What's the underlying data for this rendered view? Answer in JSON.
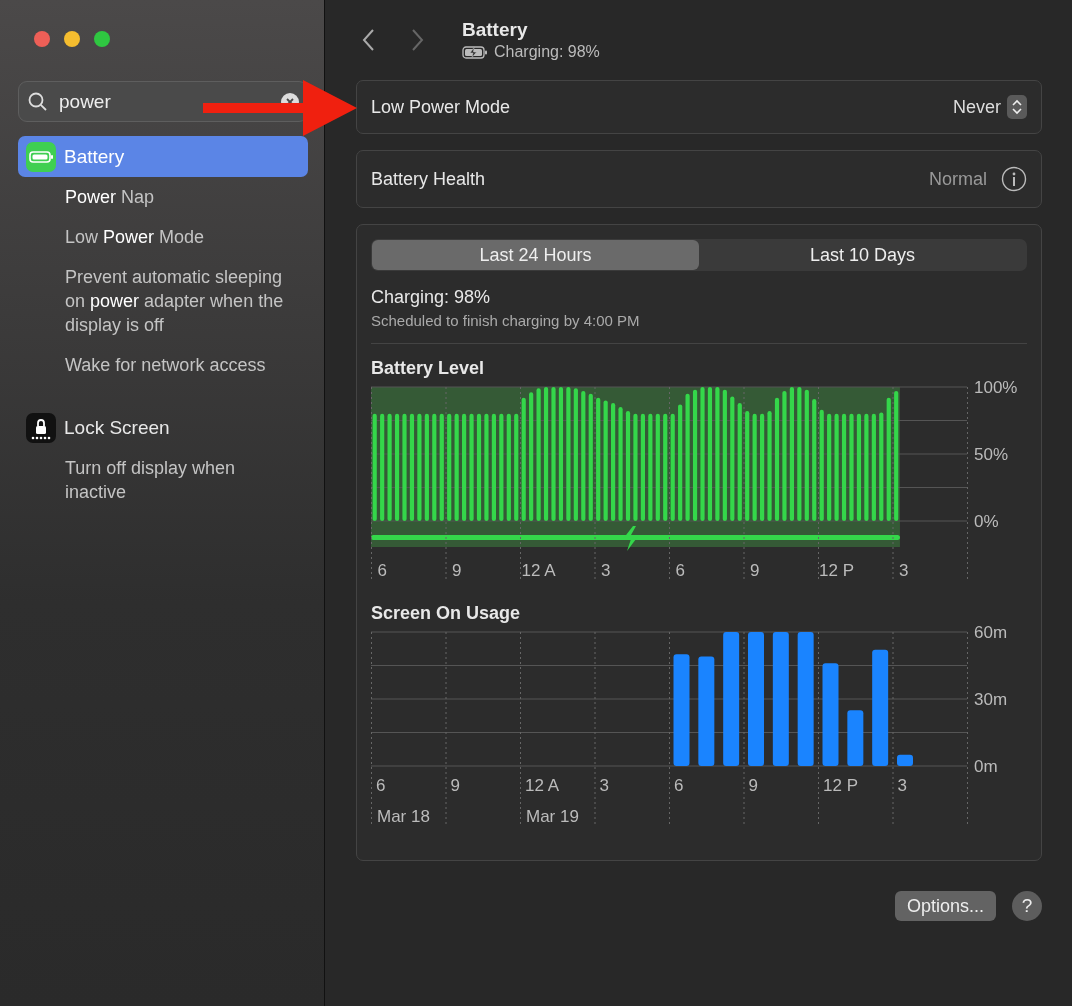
{
  "window": {
    "traffic_lights": [
      {
        "color": "#ed5f57"
      },
      {
        "color": "#f5bd2f"
      },
      {
        "color": "#2fc741"
      }
    ]
  },
  "sidebar": {
    "search": {
      "value": "power"
    },
    "items": [
      {
        "label": "Battery",
        "selected": true,
        "children": [
          {
            "label": "**Power** Nap",
            "selected": false
          },
          {
            "label": "Low **Power** Mode",
            "selected": false
          },
          {
            "label": "Prevent automatic sleeping on **power** adapter when the display is off",
            "selected": false
          },
          {
            "label": "Wake for network access",
            "selected": false
          }
        ]
      },
      {
        "label": "Lock Screen",
        "selected": false,
        "children": [
          {
            "label": "Turn off display when inactive",
            "selected": false
          }
        ]
      }
    ]
  },
  "header": {
    "title": "Battery",
    "subtitle": "Charging: 98%"
  },
  "settings": [
    {
      "kind": "popup",
      "label": "Low Power Mode",
      "value": "Never"
    },
    {
      "kind": "info",
      "label": "Battery Health",
      "value": "Normal"
    }
  ],
  "usage": {
    "tabs": [
      {
        "label": "Last 24 Hours",
        "selected": true
      },
      {
        "label": "Last 10 Days",
        "selected": false
      }
    ],
    "status": "Charging: 98%",
    "detail": "Scheduled to finish charging by 4:00 PM",
    "charts": [
      {
        "chart_data": {
          "type": "bar",
          "title": "Battery Level",
          "categories": [
            null,
            "6",
            null,
            null,
            null,
            null,
            null,
            null,
            null,
            null,
            null,
            "9",
            null,
            null,
            null,
            null,
            null,
            null,
            null,
            null,
            null,
            null,
            "12 A",
            null,
            null,
            null,
            null,
            null,
            null,
            null,
            null,
            "3",
            null,
            null,
            null,
            null,
            null,
            null,
            null,
            null,
            null,
            "6",
            null,
            null,
            null,
            null,
            null,
            null,
            null,
            null,
            null,
            "9",
            null,
            null,
            null,
            null,
            null,
            null,
            null,
            null,
            null,
            null,
            "12 P",
            null,
            null,
            null,
            null,
            null,
            null,
            null,
            null,
            "3",
            null,
            null,
            null,
            null,
            null,
            null,
            null,
            null
          ],
          "ylim": [
            0,
            100
          ],
          "yticks": [
            {
              "value": 0,
              "label": "0%"
            },
            {
              "value": 50,
              "label": "50%"
            },
            {
              "value": 100,
              "label": "100%"
            }
          ],
          "series": [
            {
              "color": "#34d74a",
              "values": [
                80,
                80,
                80,
                80,
                80,
                80,
                80,
                80,
                80,
                80,
                80,
                80,
                80,
                80,
                80,
                80,
                80,
                80,
                80,
                80,
                92,
                96,
                99,
                100,
                100,
                100,
                100,
                99,
                97,
                95,
                92,
                90,
                88,
                85,
                82,
                80,
                80,
                80,
                80,
                80,
                80,
                87,
                95,
                98,
                100,
                100,
                100,
                98,
                93,
                88,
                82,
                80,
                80,
                82,
                92,
                97,
                100,
                100,
                98,
                91,
                83,
                80,
                80,
                80,
                80,
                80,
                80,
                80,
                81,
                92,
                97,
                null,
                null,
                null,
                null,
                null,
                null,
                null,
                null,
                null
              ]
            }
          ]
        }
      },
      {
        "chart_data": {
          "type": "bar",
          "title": "Screen On Usage",
          "categories": [
            "6",
            null,
            null,
            "9",
            null,
            null,
            "12 A",
            null,
            null,
            "3",
            null,
            null,
            "6",
            null,
            null,
            "9",
            null,
            null,
            "12 P",
            null,
            null,
            "3",
            null,
            null
          ],
          "ylim": [
            0,
            60
          ],
          "yticks": [
            {
              "value": 0,
              "label": "0m"
            },
            {
              "value": 30,
              "label": "30m"
            },
            {
              "value": 60,
              "label": "60m"
            }
          ],
          "annotations": [
            "Mar 18",
            "Mar 19"
          ],
          "series": [
            {
              "color": "#1a84ff",
              "values": [
                0,
                0,
                0,
                0,
                0,
                0,
                0,
                0,
                0,
                0,
                0,
                0,
                50,
                49,
                60,
                60,
                60,
                60,
                46,
                25,
                52,
                5,
                0,
                0
              ]
            }
          ]
        }
      }
    ]
  },
  "footer": {
    "options": "Options...",
    "help": "?"
  }
}
